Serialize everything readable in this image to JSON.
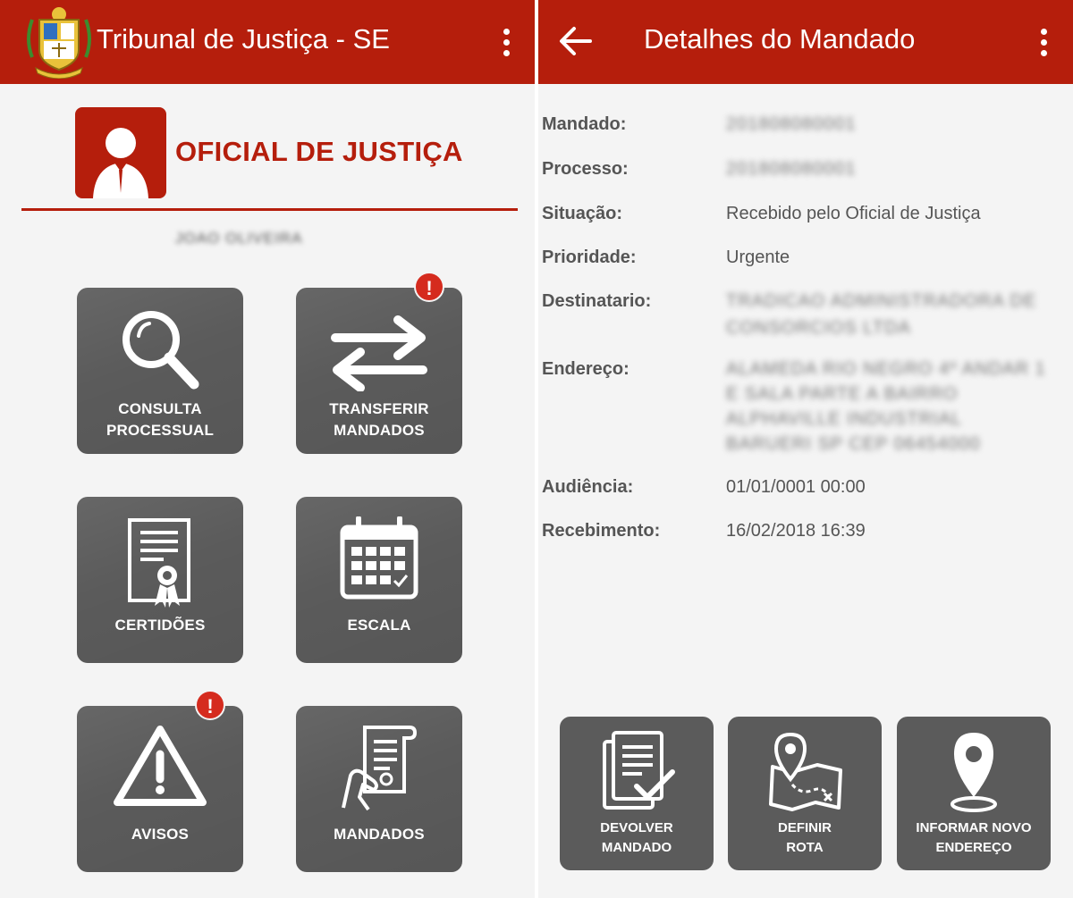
{
  "left": {
    "app_title": "Tribunal de Justiça - SE",
    "profile_title": "OFICIAL DE JUSTIÇA",
    "user_name": "JOAO OLIVEIRA",
    "tiles": [
      {
        "line1": "CONSULTA",
        "line2": "PROCESSUAL",
        "icon": "magnifier-icon",
        "badge": ""
      },
      {
        "line1": "TRANSFERIR",
        "line2": "MANDADOS",
        "icon": "transfer-arrows-icon",
        "badge": "!"
      },
      {
        "line1": "CERTIDÕES",
        "line2": "",
        "icon": "certificate-icon",
        "badge": ""
      },
      {
        "line1": "ESCALA",
        "line2": "",
        "icon": "calendar-icon",
        "badge": ""
      },
      {
        "line1": "AVISOS",
        "line2": "",
        "icon": "warning-icon",
        "badge": "!"
      },
      {
        "line1": "MANDADOS",
        "line2": "",
        "icon": "document-hand-icon",
        "badge": ""
      }
    ]
  },
  "right": {
    "title": "Detalhes do Mandado",
    "fields": [
      {
        "label": "Mandado:",
        "value": "201808080001"
      },
      {
        "label": "Processo:",
        "value": "201808080001"
      },
      {
        "label": "Situação:",
        "value": "Recebido pelo Oficial de Justiça"
      },
      {
        "label": "Prioridade:",
        "value": "Urgente"
      },
      {
        "label": "Destinatario:",
        "value_lines": [
          "TRADICAO ADMINISTRADORA DE",
          "CONSORCIOS LTDA"
        ]
      },
      {
        "label": "Endereço:",
        "value_lines": [
          "ALAMEDA RIO NEGRO 4º ANDAR 1",
          "E SALA PARTE A BAIRRO",
          "ALPHAVILLE INDUSTRIAL",
          "BARUERI SP CEP 06454000"
        ]
      },
      {
        "label": "Audiência:",
        "value": "01/01/0001 00:00"
      },
      {
        "label": "Recebimento:",
        "value": "16/02/2018 16:39"
      }
    ],
    "actions": [
      {
        "line1": "DEVOLVER",
        "line2": "MANDADO",
        "icon": "return-document-icon"
      },
      {
        "line1": "DEFINIR",
        "line2": "ROTA",
        "icon": "route-map-icon"
      },
      {
        "line1": "INFORMAR NOVO",
        "line2": "ENDEREÇO",
        "icon": "location-pin-icon"
      }
    ]
  },
  "colors": {
    "brand_red": "#b51e0c",
    "tile_gray": "#5b5b5b",
    "badge_red": "#d52b1e",
    "background": "#f4f4f4"
  }
}
